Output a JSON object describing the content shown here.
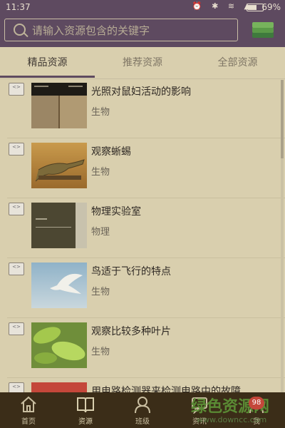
{
  "status": {
    "time": "11:37",
    "battery": "69%",
    "battery_level": 0.69,
    "icons": [
      "alarm-icon",
      "bluetooth-icon",
      "wifi-icon",
      "signal-icon"
    ]
  },
  "search": {
    "placeholder": "请输入资源包含的关键字"
  },
  "tabs": [
    {
      "label": "精品资源",
      "active": true
    },
    {
      "label": "推荐资源",
      "active": false
    },
    {
      "label": "全部资源",
      "active": false
    }
  ],
  "resources": [
    {
      "title": "光照对鼠妇活动的影响",
      "subject": "生物",
      "thumb": "soil-comparison"
    },
    {
      "title": "观察蜥蜴",
      "subject": "生物",
      "thumb": "lizard"
    },
    {
      "title": "物理实验室",
      "subject": "物理",
      "thumb": "lab"
    },
    {
      "title": "鸟适于飞行的特点",
      "subject": "生物",
      "thumb": "bird"
    },
    {
      "title": "观察比较多种叶片",
      "subject": "生物",
      "thumb": "leaves"
    },
    {
      "title": "用电路检测器来检测电路中的故障",
      "subject": "",
      "thumb": "red"
    }
  ],
  "doc_icon_label": "<>",
  "nav": [
    {
      "label": "首页",
      "icon": "home-icon",
      "active": false
    },
    {
      "label": "资源",
      "icon": "book-icon",
      "active": true
    },
    {
      "label": "班级",
      "icon": "class-icon",
      "active": false
    },
    {
      "label": "资讯",
      "icon": "news-icon",
      "active": false
    },
    {
      "label": "我",
      "icon": "me-icon",
      "active": false
    }
  ],
  "watermark": {
    "title": "绿色资源网",
    "url": "www.downcc.com"
  },
  "badge": "98",
  "colors": {
    "header": "#5e4a60",
    "background": "#d9cfae",
    "nav": "#3b2d18",
    "logo_green": "#3f7a3d"
  }
}
